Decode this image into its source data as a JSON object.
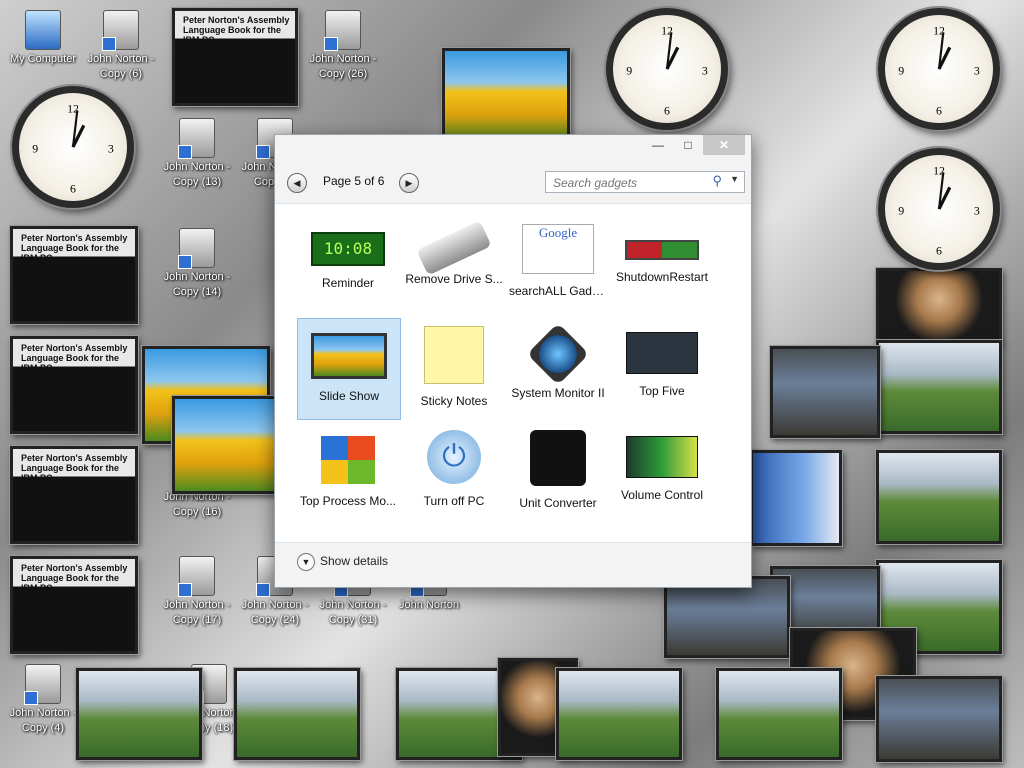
{
  "desktop": {
    "icons": [
      {
        "label": "My Computer",
        "x_note": "mycomp"
      },
      {
        "label": "John Norton - Copy (6)"
      },
      {
        "label": "John Norton - Copy (26)"
      },
      {
        "label": "John Norton - Copy (13)"
      },
      {
        "label": "John Norton - Copy (6)"
      },
      {
        "label": "John Norton - Copy (14)"
      },
      {
        "label": "John Norton - Copy (16)"
      },
      {
        "label": "John Norton - Copy (17)"
      },
      {
        "label": "John Norton - Copy (24)"
      },
      {
        "label": "John Norton - Copy (31)"
      },
      {
        "label": "John Norton"
      },
      {
        "label": "John Norton - Copy (4)"
      },
      {
        "label": "John Norton - Copy (18)"
      }
    ],
    "book_title": "Peter Norton's Assembly Language Book for the IBM PC",
    "clock_time": "1:04"
  },
  "gadget_window": {
    "page_label": "Page 5 of 6",
    "search_placeholder": "Search gadgets",
    "prev_icon": "chevron-left-icon",
    "next_icon": "chevron-right-icon",
    "gadgets": [
      {
        "label": "Reminder",
        "display": "10:08"
      },
      {
        "label": "Remove Drive S..."
      },
      {
        "label": "searchALL Gadg..."
      },
      {
        "label": "ShutdownRestart"
      },
      {
        "label": "Slide Show",
        "selected": true
      },
      {
        "label": "Sticky Notes"
      },
      {
        "label": "System Monitor II"
      },
      {
        "label": "Top Five"
      },
      {
        "label": "Top Process Mo..."
      },
      {
        "label": "Turn off PC"
      },
      {
        "label": "Unit Converter"
      },
      {
        "label": "Volume Control"
      }
    ],
    "show_details": "Show details"
  }
}
